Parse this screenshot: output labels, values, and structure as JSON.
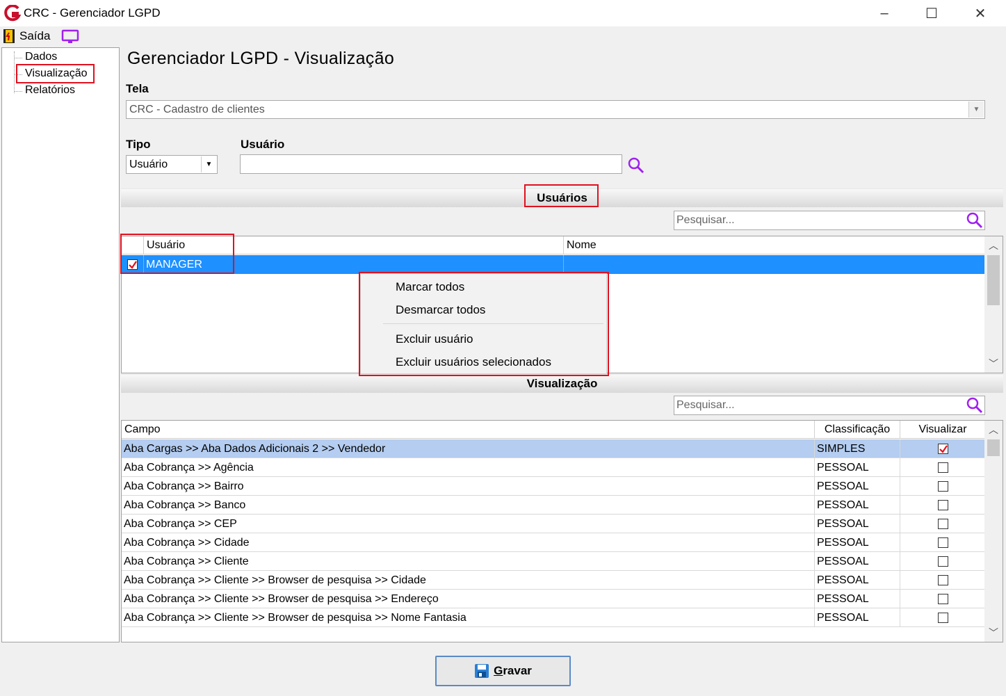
{
  "window": {
    "title": "CRC - Gerenciador LGPD",
    "minimize": "‒",
    "maximize": "☐",
    "close": "✕"
  },
  "toolbar": {
    "exit_label": "Saída"
  },
  "tree": {
    "items": [
      "Dados",
      "Visualização",
      "Relatórios"
    ],
    "selected": "Visualização"
  },
  "page": {
    "title": "Gerenciador LGPD - Visualização"
  },
  "tela": {
    "label": "Tela",
    "value": "CRC - Cadastro de clientes"
  },
  "tipo": {
    "label": "Tipo",
    "value": "Usuário"
  },
  "usuario_field": {
    "label": "Usuário",
    "value": ""
  },
  "usuarios_section": {
    "title": "Usuários",
    "search_placeholder": "Pesquisar...",
    "columns": [
      "Usuário",
      "Nome"
    ],
    "rows": [
      {
        "checked": true,
        "usuario": "MANAGER",
        "nome": ""
      }
    ]
  },
  "context_menu": {
    "items": [
      "Marcar todos",
      "Desmarcar todos",
      "Excluir usuário",
      "Excluir usuários selecionados"
    ]
  },
  "visualizacao_section": {
    "title": "Visualização",
    "search_placeholder": "Pesquisar...",
    "columns": [
      "Campo",
      "Classificação",
      "Visualizar"
    ],
    "rows": [
      {
        "campo": "Aba Cargas >> Aba Dados Adicionais 2 >> Vendedor",
        "classificacao": "SIMPLES",
        "visualizar": true
      },
      {
        "campo": "Aba Cobrança >> Agência",
        "classificacao": "PESSOAL",
        "visualizar": false
      },
      {
        "campo": "Aba Cobrança >> Bairro",
        "classificacao": "PESSOAL",
        "visualizar": false
      },
      {
        "campo": "Aba Cobrança >> Banco",
        "classificacao": "PESSOAL",
        "visualizar": false
      },
      {
        "campo": "Aba Cobrança >> CEP",
        "classificacao": "PESSOAL",
        "visualizar": false
      },
      {
        "campo": "Aba Cobrança >> Cidade",
        "classificacao": "PESSOAL",
        "visualizar": false
      },
      {
        "campo": "Aba Cobrança >> Cliente",
        "classificacao": "PESSOAL",
        "visualizar": false
      },
      {
        "campo": "Aba Cobrança >> Cliente >> Browser de pesquisa >> Cidade",
        "classificacao": "PESSOAL",
        "visualizar": false
      },
      {
        "campo": "Aba Cobrança >> Cliente >> Browser de pesquisa >> Endereço",
        "classificacao": "PESSOAL",
        "visualizar": false
      },
      {
        "campo": "Aba Cobrança >> Cliente >> Browser de pesquisa >> Nome Fantasia",
        "classificacao": "PESSOAL",
        "visualizar": false
      }
    ]
  },
  "save_button": {
    "hotkey": "G",
    "rest": "ravar"
  },
  "colors": {
    "highlight": "#1e90ff",
    "row_selected": "#b4cdf0",
    "annotation": "#e0101e",
    "accent_icon": "#a020f0"
  }
}
